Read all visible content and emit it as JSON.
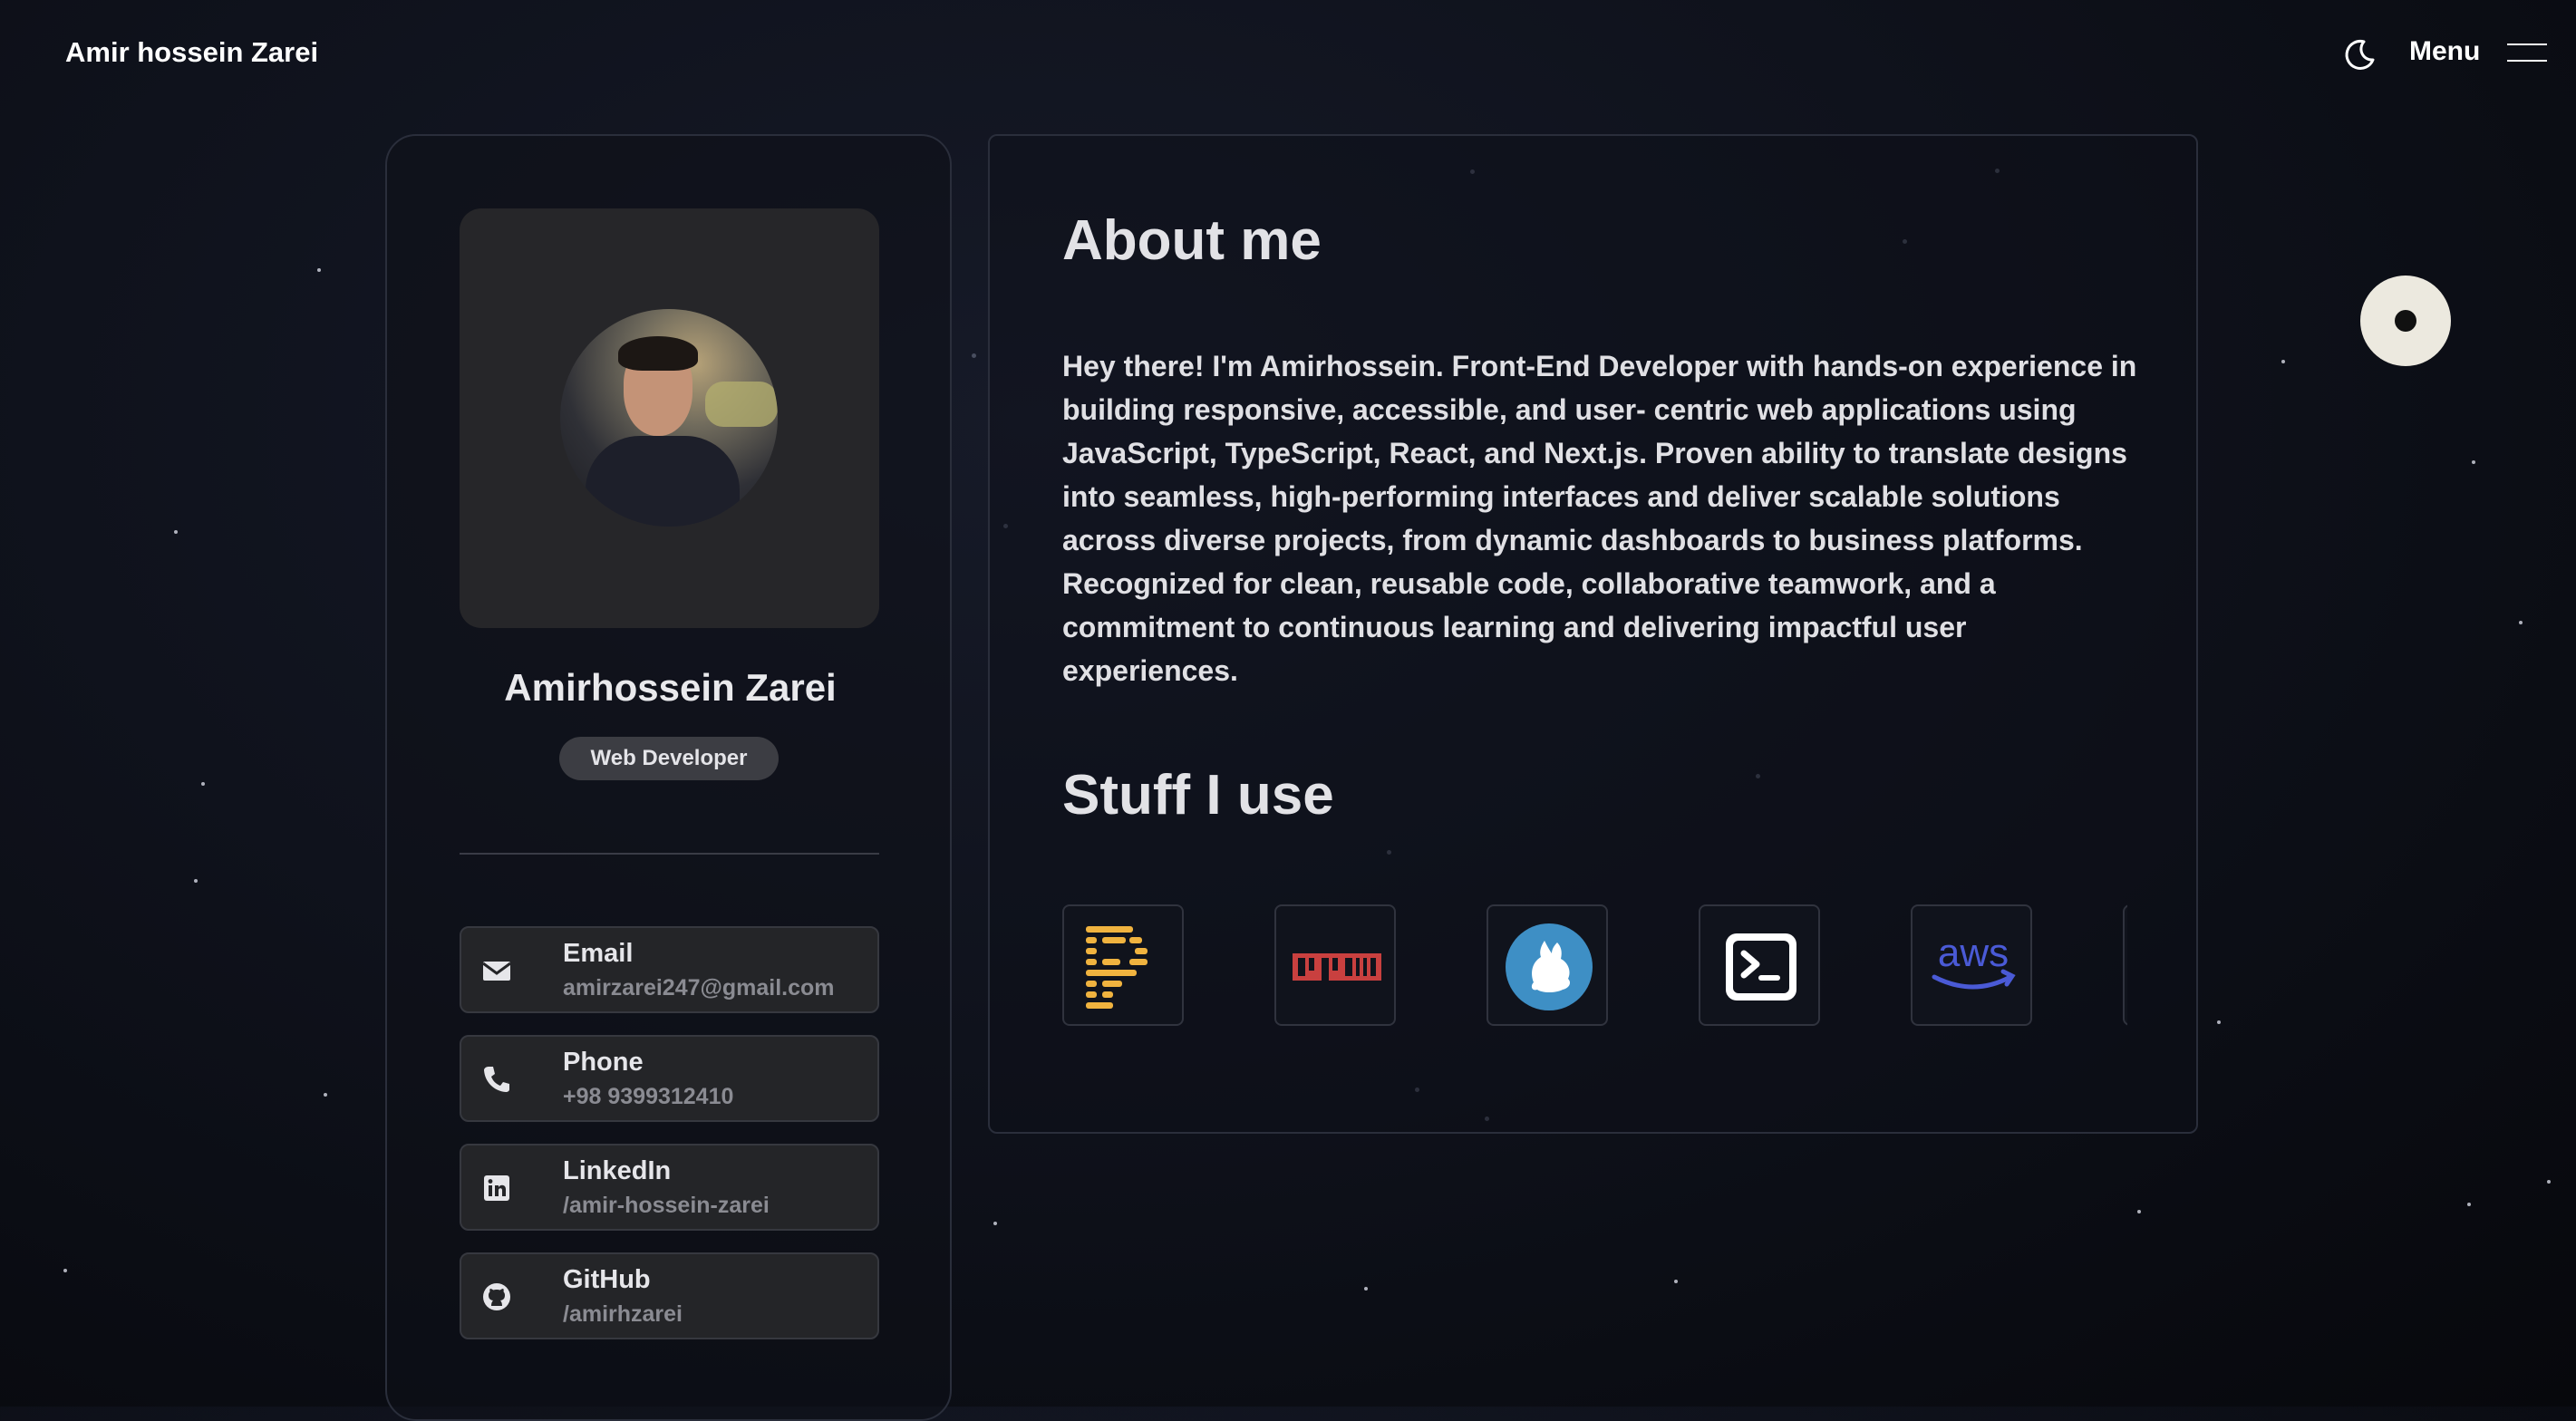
{
  "header": {
    "brand": "Amir hossein Zarei",
    "menu_label": "Menu",
    "theme_toggle_icon": "moon-icon",
    "menu_icon": "hamburger-icon"
  },
  "profile": {
    "name": "Amirhossein Zarei",
    "role": "Web Developer",
    "contacts": [
      {
        "icon": "envelope-icon",
        "label": "Email",
        "value": "amirzarei247@gmail.com"
      },
      {
        "icon": "phone-icon",
        "label": "Phone",
        "value": "+98 9399312410"
      },
      {
        "icon": "linkedin-icon",
        "label": "LinkedIn",
        "value": "/amir-hossein-zarei"
      },
      {
        "icon": "github-icon",
        "label": "GitHub",
        "value": "/amirhzarei"
      }
    ]
  },
  "about": {
    "title": "About me",
    "text": "Hey there! I'm Amirhossein. Front-End Developer with hands-on experience in building responsive, accessible, and user- centric web applications using JavaScript, TypeScript, React, and Next.js. Proven ability to translate designs into seamless, high-performing interfaces and deliver scalable solutions across diverse projects, from dynamic dashboards to business platforms. Recognized for clean, reusable code, collaborative teamwork, and a commitment to continuous learning and delivering impactful user experiences."
  },
  "stuff": {
    "title": "Stuff I use",
    "tools": [
      {
        "icon": "prettier-icon"
      },
      {
        "icon": "npm-icon",
        "text": "npm"
      },
      {
        "icon": "yarn-icon"
      },
      {
        "icon": "terminal-icon"
      },
      {
        "icon": "aws-icon",
        "text": "aws"
      }
    ]
  },
  "colors": {
    "background": "#0f121c",
    "card_border": "#2a2e3b",
    "npm_red": "#c9403f",
    "yarn_blue": "#3e8fc5",
    "aws_purple": "#4a5ad6",
    "prettier_yellow": "#f0b33f"
  }
}
